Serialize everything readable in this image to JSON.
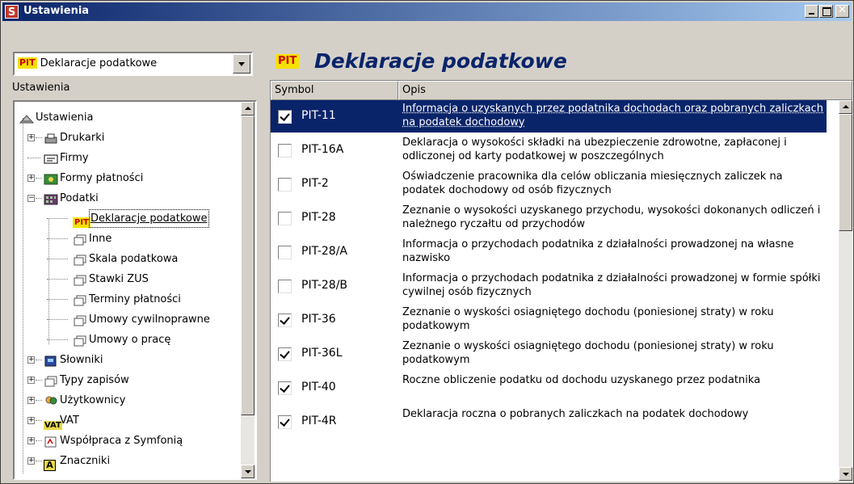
{
  "window": {
    "title": "Ustawienia",
    "icon_letter": "S",
    "close_glyph": "✕"
  },
  "left": {
    "combo_badge": "PIT",
    "combo_value": "Deklaracje podatkowe",
    "section_label": "Ustawienia",
    "tree": [
      {
        "label": "Ustawienia",
        "icon": "settings-icon",
        "level": 0,
        "expander": ""
      },
      {
        "label": "Drukarki",
        "icon": "printer-icon",
        "level": 1,
        "expander": "+"
      },
      {
        "label": "Firmy",
        "icon": "company-icon",
        "level": 1,
        "expander": ""
      },
      {
        "label": "Formy płatności",
        "icon": "payment-icon",
        "level": 1,
        "expander": "+"
      },
      {
        "label": "Podatki",
        "icon": "tax-icon",
        "level": 1,
        "expander": "−"
      },
      {
        "label": "Deklaracje podatkowe",
        "icon": "pit-icon",
        "level": 2,
        "expander": "",
        "selected": true
      },
      {
        "label": "Inne",
        "icon": "document-icon",
        "level": 2,
        "expander": ""
      },
      {
        "label": "Skala podatkowa",
        "icon": "document-icon",
        "level": 2,
        "expander": ""
      },
      {
        "label": "Stawki ZUS",
        "icon": "document-icon",
        "level": 2,
        "expander": ""
      },
      {
        "label": "Terminy płatności",
        "icon": "document-icon",
        "level": 2,
        "expander": ""
      },
      {
        "label": "Umowy cywilnoprawne",
        "icon": "document-icon",
        "level": 2,
        "expander": ""
      },
      {
        "label": "Umowy o pracę",
        "icon": "document-icon",
        "level": 2,
        "expander": ""
      },
      {
        "label": "Słowniki",
        "icon": "dictionary-icon",
        "level": 1,
        "expander": "+"
      },
      {
        "label": "Typy zapisów",
        "icon": "document-icon",
        "level": 1,
        "expander": "+"
      },
      {
        "label": "Użytkownicy",
        "icon": "users-icon",
        "level": 1,
        "expander": "+"
      },
      {
        "label": "VAT",
        "icon": "vat-icon",
        "level": 1,
        "expander": "+"
      },
      {
        "label": "Współpraca z Symfonią",
        "icon": "sync-icon",
        "level": 1,
        "expander": "+"
      },
      {
        "label": "Znaczniki",
        "icon": "marker-icon",
        "level": 1,
        "expander": "+"
      }
    ],
    "icon_text": {
      "pit": "PIT",
      "vat": "VAT",
      "marker": "A"
    }
  },
  "right": {
    "badge": "PIT",
    "title": "Deklaracje podatkowe",
    "columns": {
      "symbol": "Symbol",
      "description": "Opis"
    },
    "rows": [
      {
        "symbol": "PIT-11",
        "checked": true,
        "selected": true,
        "description": "Informacja o uzyskanych przez podatnika dochodach oraz pobranych zaliczkach na podatek dochodowy"
      },
      {
        "symbol": "PIT-16A",
        "checked": false,
        "description": "Deklaracja o wysokości składki na ubezpieczenie zdrowotne, zapłaconej i odliczonej od karty podatkowej w poszczególnych"
      },
      {
        "symbol": "PIT-2",
        "checked": false,
        "description": "Oświadczenie pracownika dla celów obliczania miesięcznych zaliczek na podatek dochodowy od osób fizycznych"
      },
      {
        "symbol": "PIT-28",
        "checked": false,
        "description": "Zeznanie o wysokości uzyskanego przychodu, wysokości dokonanych odliczeń i należnego ryczałtu od przychodów"
      },
      {
        "symbol": "PIT-28/A",
        "checked": false,
        "description": "Informacja o przychodach podatnika z działalności prowadzonej na własne nazwisko"
      },
      {
        "symbol": "PIT-28/B",
        "checked": false,
        "description": "Informacja o przychodach podatnika z działalności prowadzonej w formie spółki cywilnej osób fizycznych"
      },
      {
        "symbol": "PIT-36",
        "checked": true,
        "description": "Zeznanie o wyskości osiagniętego dochodu (poniesionej straty) w roku podatkowym"
      },
      {
        "symbol": "PIT-36L",
        "checked": true,
        "description": "Zeznanie o wyskości osiagniętego dochodu (poniesionej straty) w roku podatkowym"
      },
      {
        "symbol": "PIT-40",
        "checked": true,
        "description": "Roczne obliczenie podatku od dochodu uzyskanego przez podatnika"
      },
      {
        "symbol": "PIT-4R",
        "checked": true,
        "description": "Deklaracja roczna o pobranych zaliczkach na podatek dochodowy"
      }
    ]
  },
  "colors": {
    "title_bar": "#0a246a",
    "selection": "#0a246a",
    "face": "#d4d0c8"
  }
}
